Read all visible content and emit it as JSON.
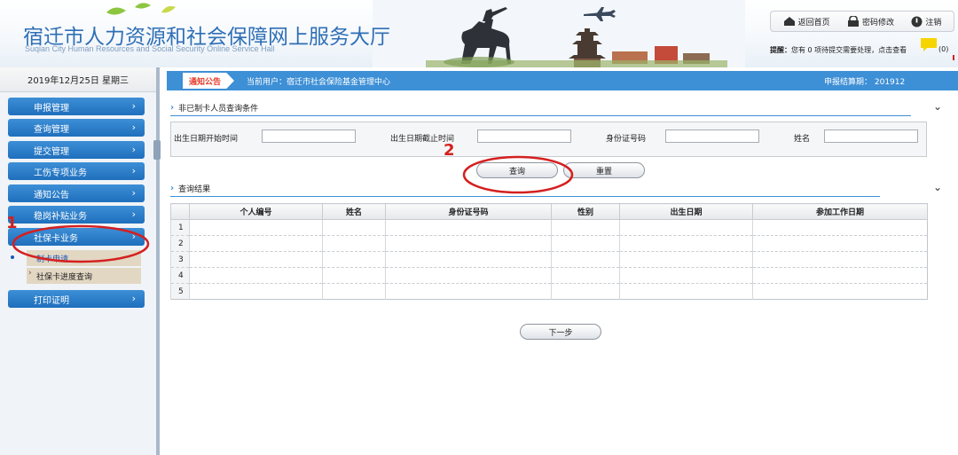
{
  "header": {
    "title": "宿迁市人力资源和社会保障网上服务大厅",
    "subtitle": "Suqian City Human Resources and Social Security Online Service Hall",
    "buttons": {
      "home": "返回首页",
      "password": "密码修改",
      "logout": "注销"
    },
    "notice_prefix": "提醒：",
    "notice_text": "您有 0 项待提交需要处理，点击查看",
    "notice_count": "(0)"
  },
  "sidebar": {
    "date": "2019年12月25日 星期三",
    "items": [
      {
        "label": "申报管理"
      },
      {
        "label": "查询管理"
      },
      {
        "label": "提交管理"
      },
      {
        "label": "工伤专项业务"
      },
      {
        "label": "通知公告"
      },
      {
        "label": "稳岗补贴业务"
      },
      {
        "label": "社保卡业务"
      },
      {
        "label": "打印证明"
      }
    ],
    "subitems": [
      {
        "label": "制卡申请"
      },
      {
        "label": "社保卡进度查询"
      }
    ]
  },
  "topstrip": {
    "notice_tab": "通知公告",
    "current_user": "当前用户：宿迁市社会保险基金管理中心",
    "period": "申报结算期： 201912"
  },
  "criteria": {
    "title": "非已制卡人员查询条件",
    "fields": [
      {
        "label": "出生日期开始时间",
        "value": ""
      },
      {
        "label": "出生日期截止时间",
        "value": ""
      },
      {
        "label": "身份证号码",
        "value": ""
      },
      {
        "label": "姓名",
        "value": ""
      }
    ]
  },
  "actions": {
    "query": "查询",
    "reset": "重置",
    "next": "下一步"
  },
  "results": {
    "title": "查询结果",
    "columns": [
      "",
      "个人编号",
      "姓名",
      "身份证号码",
      "性别",
      "出生日期",
      "参加工作日期"
    ],
    "rows": [
      "1",
      "2",
      "3",
      "4",
      "5"
    ]
  },
  "annotations": {
    "step1": "1",
    "step2": "2",
    "color": "#d42020"
  },
  "colors": {
    "accent": "#3d8fd6",
    "menu": "#1f6fbd",
    "title": "#2f6fb5"
  }
}
